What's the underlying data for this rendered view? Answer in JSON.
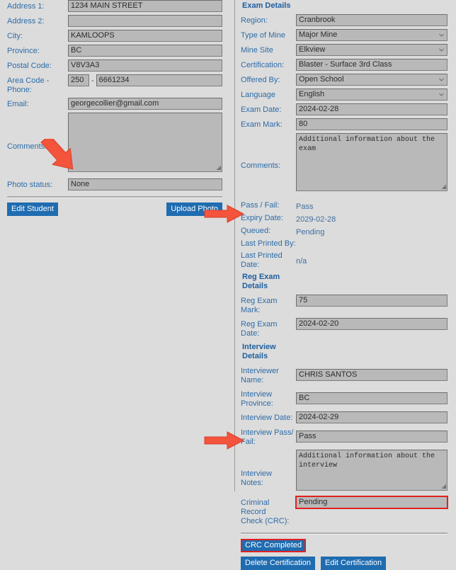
{
  "student": {
    "fields": [
      {
        "label": "Address 1:",
        "value": "1234 MAIN STREET",
        "type": "text"
      },
      {
        "label": "Address 2:",
        "value": "",
        "type": "text"
      },
      {
        "label": "City:",
        "value": "KAMLOOPS",
        "type": "text"
      },
      {
        "label": "Province:",
        "value": "BC",
        "type": "text"
      },
      {
        "label": "Postal Code:",
        "value": "V8V3A3",
        "type": "text"
      }
    ],
    "phone": {
      "label": "Area Code - Phone:",
      "label_line1": "Area Code -",
      "label_line2": "Phone:",
      "area_code": "250",
      "separator": "-",
      "number": "6661234"
    },
    "email": {
      "label": "Email:",
      "value": "georgecollier@gmail.com"
    },
    "comments": {
      "label": "Comments:",
      "value": ""
    },
    "photo_status": {
      "label": "Photo status:",
      "value": "None"
    },
    "buttons": {
      "edit_student": "Edit Student",
      "upload_photo": "Upload Photo"
    }
  },
  "exam": {
    "section_title": "Exam Details",
    "region": {
      "label": "Region:",
      "value": "Cranbrook"
    },
    "type_of_mine": {
      "label": "Type of Mine",
      "value": "Major Mine"
    },
    "mine_site": {
      "label": "Mine Site",
      "value": "Elkview"
    },
    "certification": {
      "label": "Certification:",
      "value": "Blaster - Surface 3rd Class"
    },
    "offered_by": {
      "label": "Offered By:",
      "value": "Open School"
    },
    "language": {
      "label": "Language",
      "value": "English"
    },
    "exam_date": {
      "label": "Exam Date:",
      "value": "2024-02-28"
    },
    "exam_mark": {
      "label": "Exam Mark:",
      "value": "80"
    },
    "comments": {
      "label": "Comments:",
      "value": "Additional information about the exam"
    },
    "pass_fail": {
      "label": "Pass / Fail:",
      "value": "Pass"
    },
    "expiry_date": {
      "label": "Expiry Date:",
      "value": "2029-02-28"
    },
    "queued": {
      "label": "Queued:",
      "value": "Pending"
    },
    "last_printed_by": {
      "label": "Last Printed By:",
      "value": ""
    },
    "last_printed_date": {
      "label": "Last Printed Date:",
      "label_line1": "Last Printed",
      "label_line2": "Date:",
      "value": "n/a"
    }
  },
  "reg_exam": {
    "section_title_line1": "Reg Exam",
    "section_title_line2": "Details",
    "mark": {
      "label": "Reg Exam Mark:",
      "value": "75"
    },
    "date": {
      "label": "Reg Exam Date:",
      "value": "2024-02-20"
    }
  },
  "interview": {
    "section_title_line1": "Interview",
    "section_title_line2": "Details",
    "interviewer_name": {
      "label_line1": "Interviewer",
      "label_line2": "Name:",
      "value": "CHRIS SANTOS"
    },
    "province": {
      "label_line1": "Interview",
      "label_line2": "Province:",
      "value": "BC"
    },
    "date": {
      "label": "Interview Date:",
      "value": "2024-02-29"
    },
    "pass_fail": {
      "label_line1": "Interview Pass/",
      "label_line2": "Fail:",
      "value": "Pass"
    },
    "notes": {
      "label": "Interview Notes:",
      "value": "Additional information about the\ninterview"
    }
  },
  "crc": {
    "label_line1": "Criminal Record",
    "label_line2": "Check (CRC):",
    "value": "Pending"
  },
  "footer_buttons": {
    "crc_completed": "CRC Completed",
    "delete_certification": "Delete Certification",
    "edit_certification": "Edit Certification"
  },
  "annotations": {
    "arrow_photo_status": "arrow-pointing-to-photo-status",
    "arrow_queued": "arrow-pointing-to-queued",
    "arrow_crc": "arrow-pointing-to-crc"
  },
  "colors": {
    "label_blue": "#2d6ca8",
    "button_blue": "#1f6cb0",
    "highlight_red": "#e02020",
    "field_gray": "#b9b9b9",
    "page_gray": "#dcdcdc"
  }
}
